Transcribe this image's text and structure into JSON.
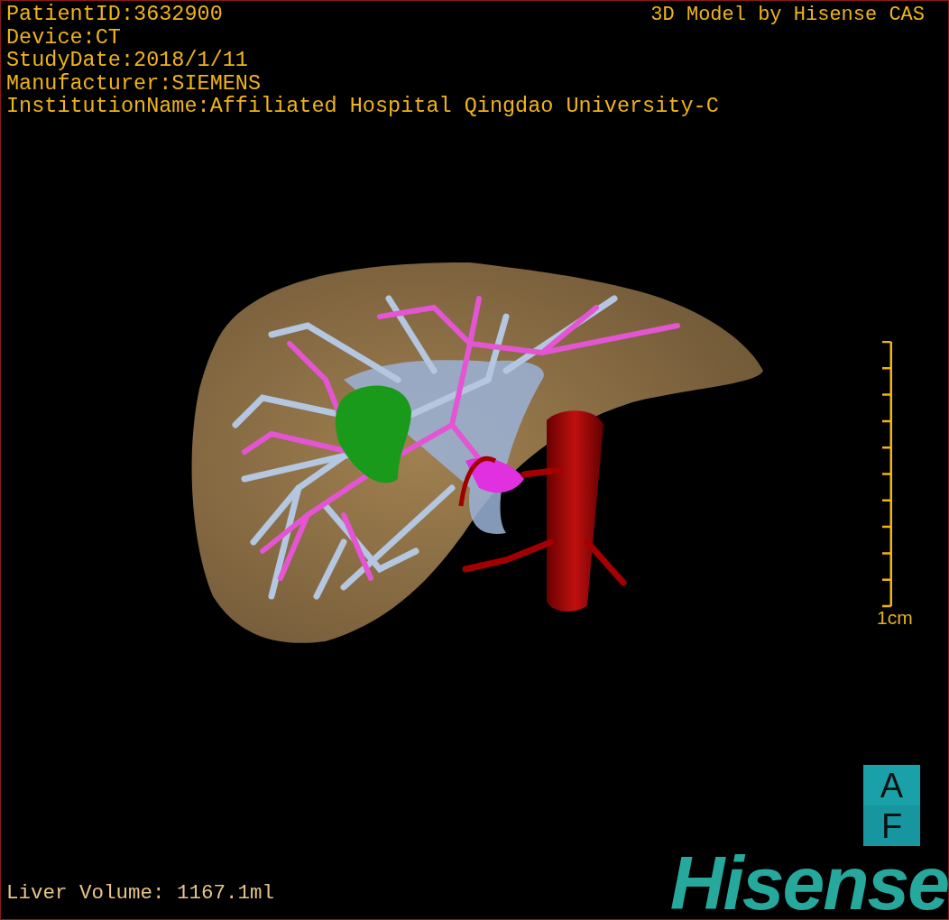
{
  "info_lines": [
    "PatientID:3632900",
    "Device:CT",
    "StudyDate:2018/1/11",
    "Manufacturer:SIEMENS",
    "InstitutionName:Affiliated Hospital Qingdao University-C"
  ],
  "title": "3D Model by Hisense CAS",
  "scale_bar": {
    "label": "1cm"
  },
  "orientation_cube": {
    "top": "A",
    "bottom": "F"
  },
  "measurement": "Liver Volume: 1167.1ml",
  "logo": "Hisense"
}
